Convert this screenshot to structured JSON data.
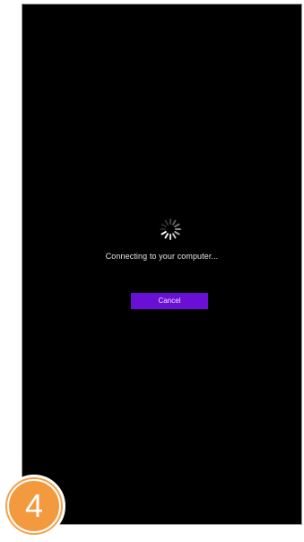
{
  "screen": {
    "status_text": "Connecting to your computer...",
    "cancel_label": "Cancel"
  },
  "step": {
    "number": "4"
  },
  "colors": {
    "screen_background": "#000000",
    "cancel_button": "#6a0fd6",
    "step_badge": "#f39a3f"
  },
  "icons": {
    "spinner": "loading-spinner-icon"
  }
}
